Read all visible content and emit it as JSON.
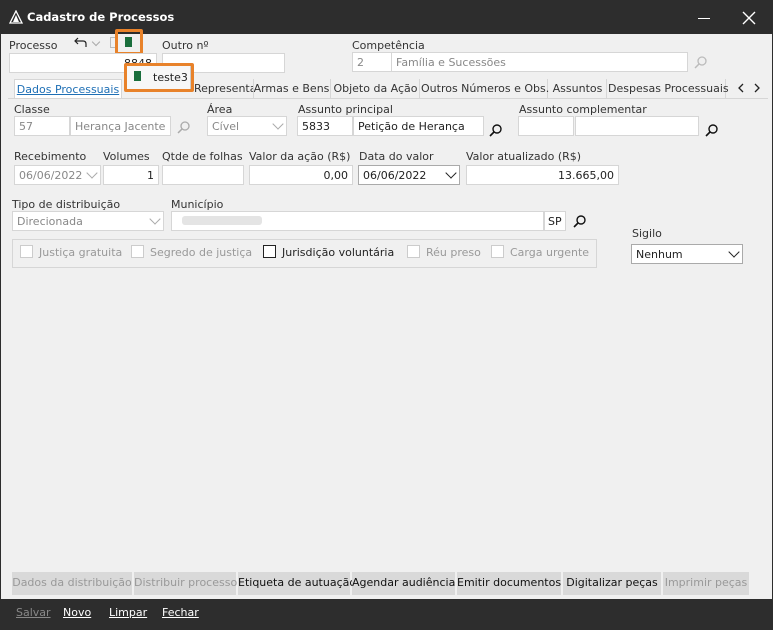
{
  "window": {
    "title": "Cadastro de Processos"
  },
  "header": {
    "processo_label": "Processo",
    "processo_value": "8848",
    "outro_label": "Outro nº",
    "outro_value": "",
    "competencia_label": "Competência",
    "competencia_code": "2",
    "competencia_value": "Família e Sucessões",
    "dropdown_item": "teste3"
  },
  "tabs": [
    {
      "label": "Dados Processuais",
      "active": true
    },
    {
      "label": "Representantes"
    },
    {
      "label": "Armas e Bens"
    },
    {
      "label": "Objeto da Ação"
    },
    {
      "label": "Outros Números e Obs."
    },
    {
      "label": "Assuntos"
    },
    {
      "label": "Despesas Processuais"
    }
  ],
  "form": {
    "classe_label": "Classe",
    "classe_code": "57",
    "classe_name": "Herança Jacente",
    "area_label": "Área",
    "area_value": "Cível",
    "assunto_principal_label": "Assunto principal",
    "assunto_principal_code": "5833",
    "assunto_principal_name": "Petição de Herança",
    "assunto_complementar_label": "Assunto complementar",
    "recebimento_label": "Recebimento",
    "recebimento_value": "06/06/2022",
    "volumes_label": "Volumes",
    "volumes_value": "1",
    "qtde_folhas_label": "Qtde de folhas",
    "qtde_folhas_value": "",
    "valor_acao_label": "Valor da ação (R$)",
    "valor_acao_value": "0,00",
    "data_valor_label": "Data do valor",
    "data_valor_value": "06/06/2022",
    "valor_atualizado_label": "Valor atualizado (R$)",
    "valor_atualizado_value": "13.665,00",
    "tipo_distribuicao_label": "Tipo de distribuição",
    "tipo_distribuicao_value": "Direcionada",
    "municipio_label": "Município",
    "municipio_uf": "SP",
    "sigilo_label": "Sigilo",
    "sigilo_value": "Nenhum"
  },
  "checkboxes": [
    {
      "label": "Justiça gratuita",
      "enabled": false
    },
    {
      "label": "Segredo de justiça",
      "enabled": false
    },
    {
      "label": "Jurisdição voluntária",
      "enabled": true
    },
    {
      "label": "Réu preso",
      "enabled": false
    },
    {
      "label": "Carga urgente",
      "enabled": false
    }
  ],
  "action_buttons": [
    {
      "label": "Dados da distribuição",
      "enabled": false
    },
    {
      "label": "Distribuir processo",
      "enabled": false
    },
    {
      "label": "Etiqueta de autuação",
      "enabled": true
    },
    {
      "label": "Agendar audiência",
      "enabled": true
    },
    {
      "label": "Emitir documentos",
      "enabled": true
    },
    {
      "label": "Digitalizar peças",
      "enabled": true
    },
    {
      "label": "Imprimir peças",
      "enabled": false
    }
  ],
  "footer": {
    "salvar": "Salvar",
    "novo": "Novo",
    "limpar": "Limpar",
    "fechar": "Fechar"
  },
  "colors": {
    "highlight": "#e8822a",
    "active_tab": "#1e6fb5",
    "titlebar": "#2d2d2d",
    "doc_icon": "#1a6e3c"
  }
}
